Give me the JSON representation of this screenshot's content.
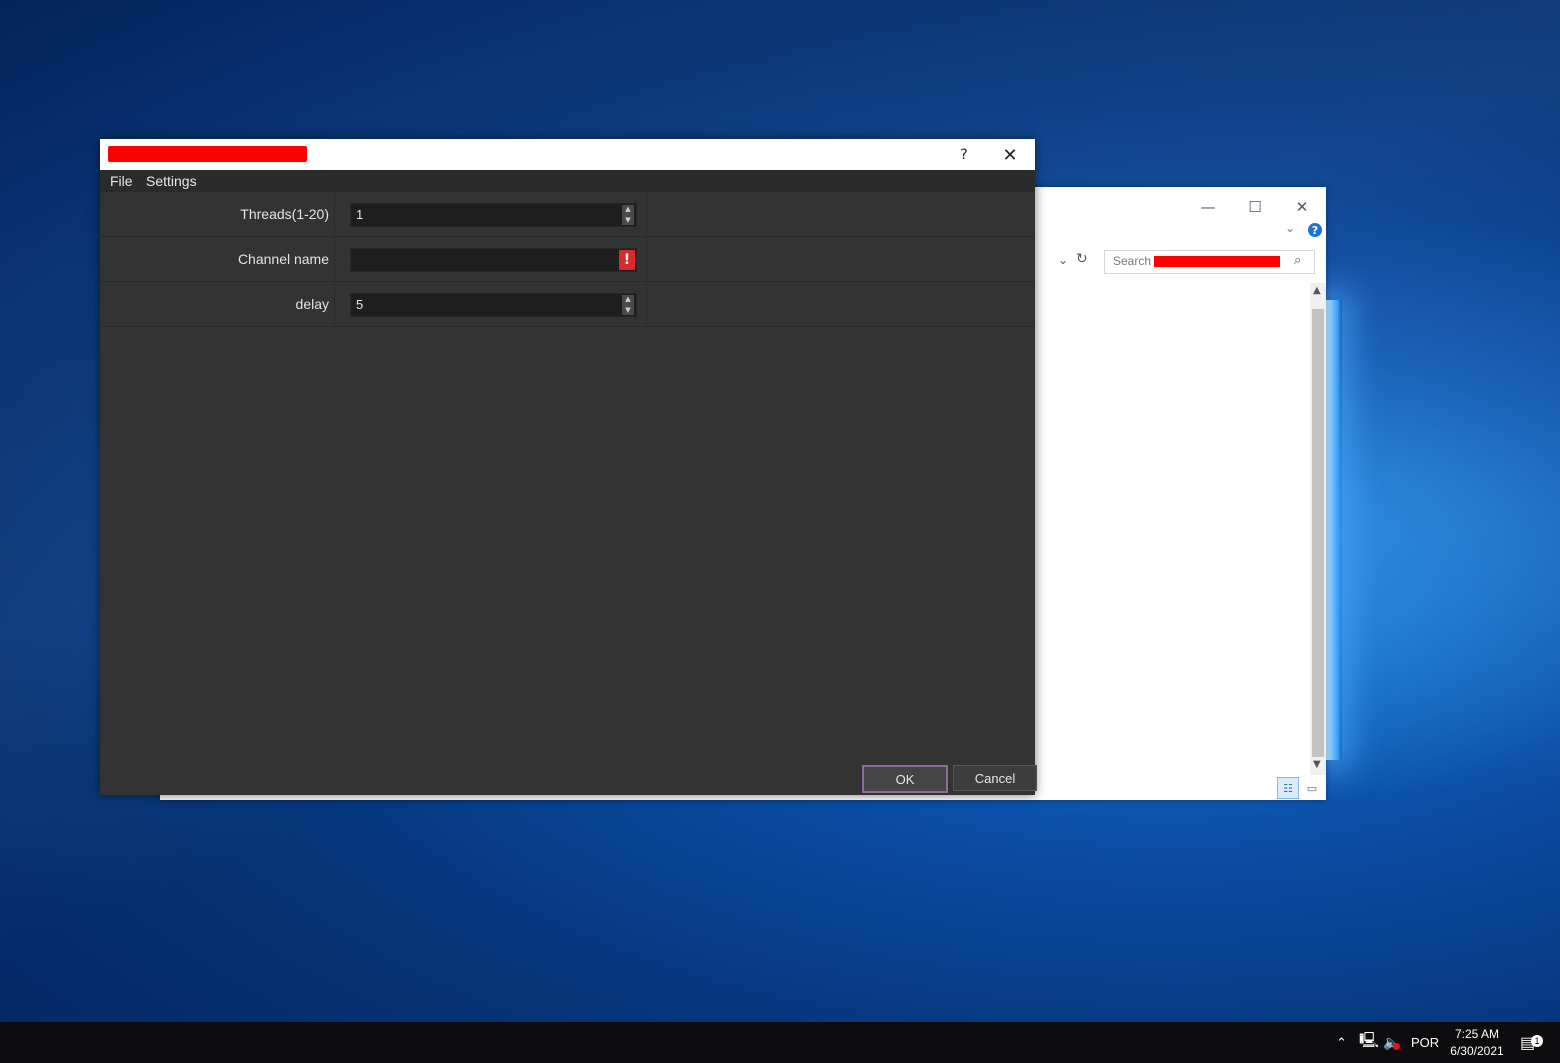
{
  "dialog": {
    "menu": [
      "File",
      "Settings"
    ],
    "help_glyph": "?",
    "close_glyph": "✕",
    "fields": [
      {
        "label": "Threads(1-20)",
        "value": "1",
        "control": "spinbox"
      },
      {
        "label": "Channel name",
        "value": "",
        "control": "text-warning",
        "warning_glyph": "!"
      },
      {
        "label": "delay",
        "value": "5",
        "control": "spinbox"
      }
    ],
    "ok_label": "OK",
    "cancel_label": "Cancel"
  },
  "explorer": {
    "search_placeholder": "Search",
    "minimize_glyph": "—",
    "maximize_glyph": "☐",
    "close_glyph": "✕",
    "help_glyph": "?"
  },
  "taskbar": {
    "language": "POR",
    "time": "7:25 AM",
    "date": "6/30/2021",
    "notification_count": "1"
  },
  "colors": {
    "dialog_bg": "#333333",
    "field_bg": "#1e1e1e",
    "warning": "#d82a2a",
    "redaction": "#ff0000",
    "ok_border": "#8d6a9e"
  },
  "icons": [
    "help-icon",
    "close-icon",
    "spin-up-icon",
    "spin-down-icon",
    "warning-icon",
    "refresh-icon",
    "search-icon",
    "chevron-down-icon",
    "tray-chevron-icon",
    "network-icon",
    "volume-muted-icon",
    "notification-icon"
  ]
}
